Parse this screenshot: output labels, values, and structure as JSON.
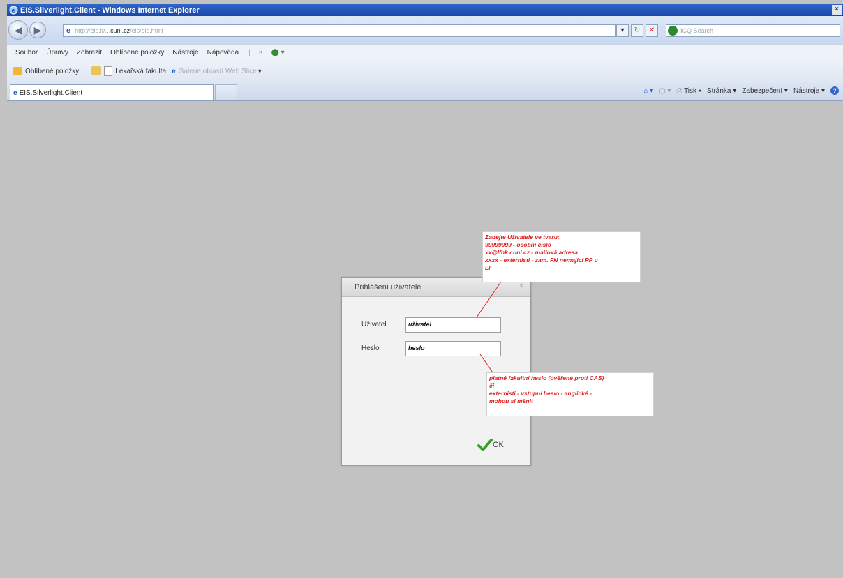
{
  "window": {
    "title": "EIS.Silverlight.Client - Windows Internet Explorer",
    "close_glyph": "×"
  },
  "address_bar": {
    "url_prefix": "http://eis.lf/...",
    "url_domain": "cuni.cz",
    "url_suffix": "/eis/eis.html",
    "search_placeholder": "ICQ Search"
  },
  "menu": {
    "items": [
      "Soubor",
      "Úpravy",
      "Zobrazit",
      "Oblíbené položky",
      "Nástroje",
      "Nápověda"
    ]
  },
  "favorites": {
    "label": "Oblíbené položky",
    "items": [
      "Lékařská fakulta",
      "Galerie oblastí Web Slice"
    ]
  },
  "tab": {
    "title": "EIS.Silverlight.Client"
  },
  "command_bar": {
    "items": [
      "Tisk",
      "Stránka",
      "Zabezpečení",
      "Nástroje"
    ]
  },
  "dialog": {
    "title": "Přihlášení uživatele",
    "close_glyph": "×",
    "user_label": "Uživatel",
    "user_value": "uživatel",
    "password_label": "Heslo",
    "password_value": "heslo",
    "ok_label": "OK"
  },
  "callouts": {
    "user_hint": [
      "Zadejte Uživatele ve tvaru:",
      "99999999 - osobní číslo",
      "xx@lfhk.cuni.cz - mailová adresa",
      "xxxx - externisti - zam. FN nemající PP u",
      "LF"
    ],
    "password_hint": [
      "platné fakultní heslo (ověřené proti CAS)",
      "či",
      "externisti - vstupní heslo - anglické -",
      "mohou si měnit"
    ],
    "color": "#e02020"
  }
}
